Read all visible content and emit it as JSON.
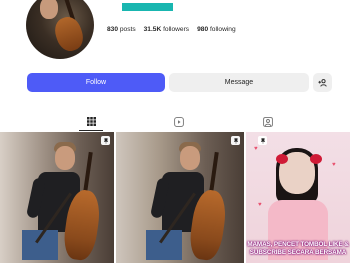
{
  "profile": {
    "posts_count": "830",
    "posts_label": "posts",
    "followers_count": "31.5K",
    "followers_label": "followers",
    "following_count": "980",
    "following_label": "following"
  },
  "actions": {
    "follow_label": "Follow",
    "message_label": "Message",
    "add_user_icon": "add-user-icon"
  },
  "tabs": [
    {
      "icon": "grid-icon",
      "active": true
    },
    {
      "icon": "reels-icon",
      "active": false
    },
    {
      "icon": "tagged-icon",
      "active": false
    }
  ],
  "posts": [
    {
      "pinned": true,
      "pin_icon": "pin-icon"
    },
    {
      "pinned": true,
      "pin_icon": "pin-icon"
    },
    {
      "pinned": true,
      "pin_icon": "pin-icon",
      "overlay_line1": "MAMAS, PENCET TOMBOL LIKE &",
      "overlay_line2": "SUBSCRIBE SECARA BERSAMA"
    }
  ],
  "colors": {
    "accent": "#4e5bf7",
    "username_highlight": "#19b6b0",
    "secondary_button": "#efefef"
  }
}
